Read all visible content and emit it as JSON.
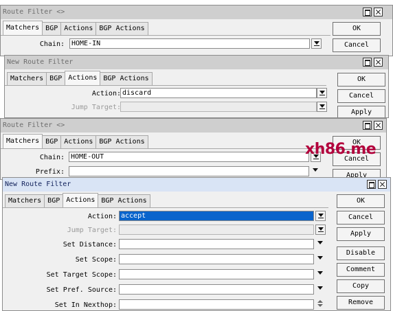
{
  "watermark": "xh86.me",
  "window1": {
    "title": "Route Filter <>",
    "tabs": [
      "Matchers",
      "BGP",
      "Actions",
      "BGP Actions"
    ],
    "chain_label": "Chain:",
    "chain_value": "HOME-IN",
    "buttons": [
      "OK",
      "Cancel"
    ]
  },
  "window2": {
    "title": "New Route Filter",
    "tabs": [
      "Matchers",
      "BGP",
      "Actions",
      "BGP Actions"
    ],
    "action_label": "Action:",
    "action_value": "discard",
    "jump_label": "Jump Target:",
    "buttons": [
      "OK",
      "Cancel",
      "Apply"
    ]
  },
  "window3": {
    "title": "Route Filter <>",
    "tabs": [
      "Matchers",
      "BGP",
      "Actions",
      "BGP Actions"
    ],
    "chain_label": "Chain:",
    "chain_value": "HOME-OUT",
    "prefix_label": "Prefix:",
    "buttons": [
      "OK",
      "Cancel",
      "Apply"
    ]
  },
  "window4": {
    "title": "New Route Filter",
    "tabs": [
      "Matchers",
      "BGP",
      "Actions",
      "BGP Actions"
    ],
    "fields": {
      "action_label": "Action:",
      "action_value": "accept",
      "jump_label": "Jump Target:",
      "distance_label": "Set Distance:",
      "scope_label": "Set Scope:",
      "target_scope_label": "Set Target Scope:",
      "pref_source_label": "Set Pref. Source:",
      "in_nexthop_label": "Set In Nexthop:"
    },
    "buttons": [
      "OK",
      "Cancel",
      "Apply",
      "Disable",
      "Comment",
      "Copy",
      "Remove"
    ]
  }
}
